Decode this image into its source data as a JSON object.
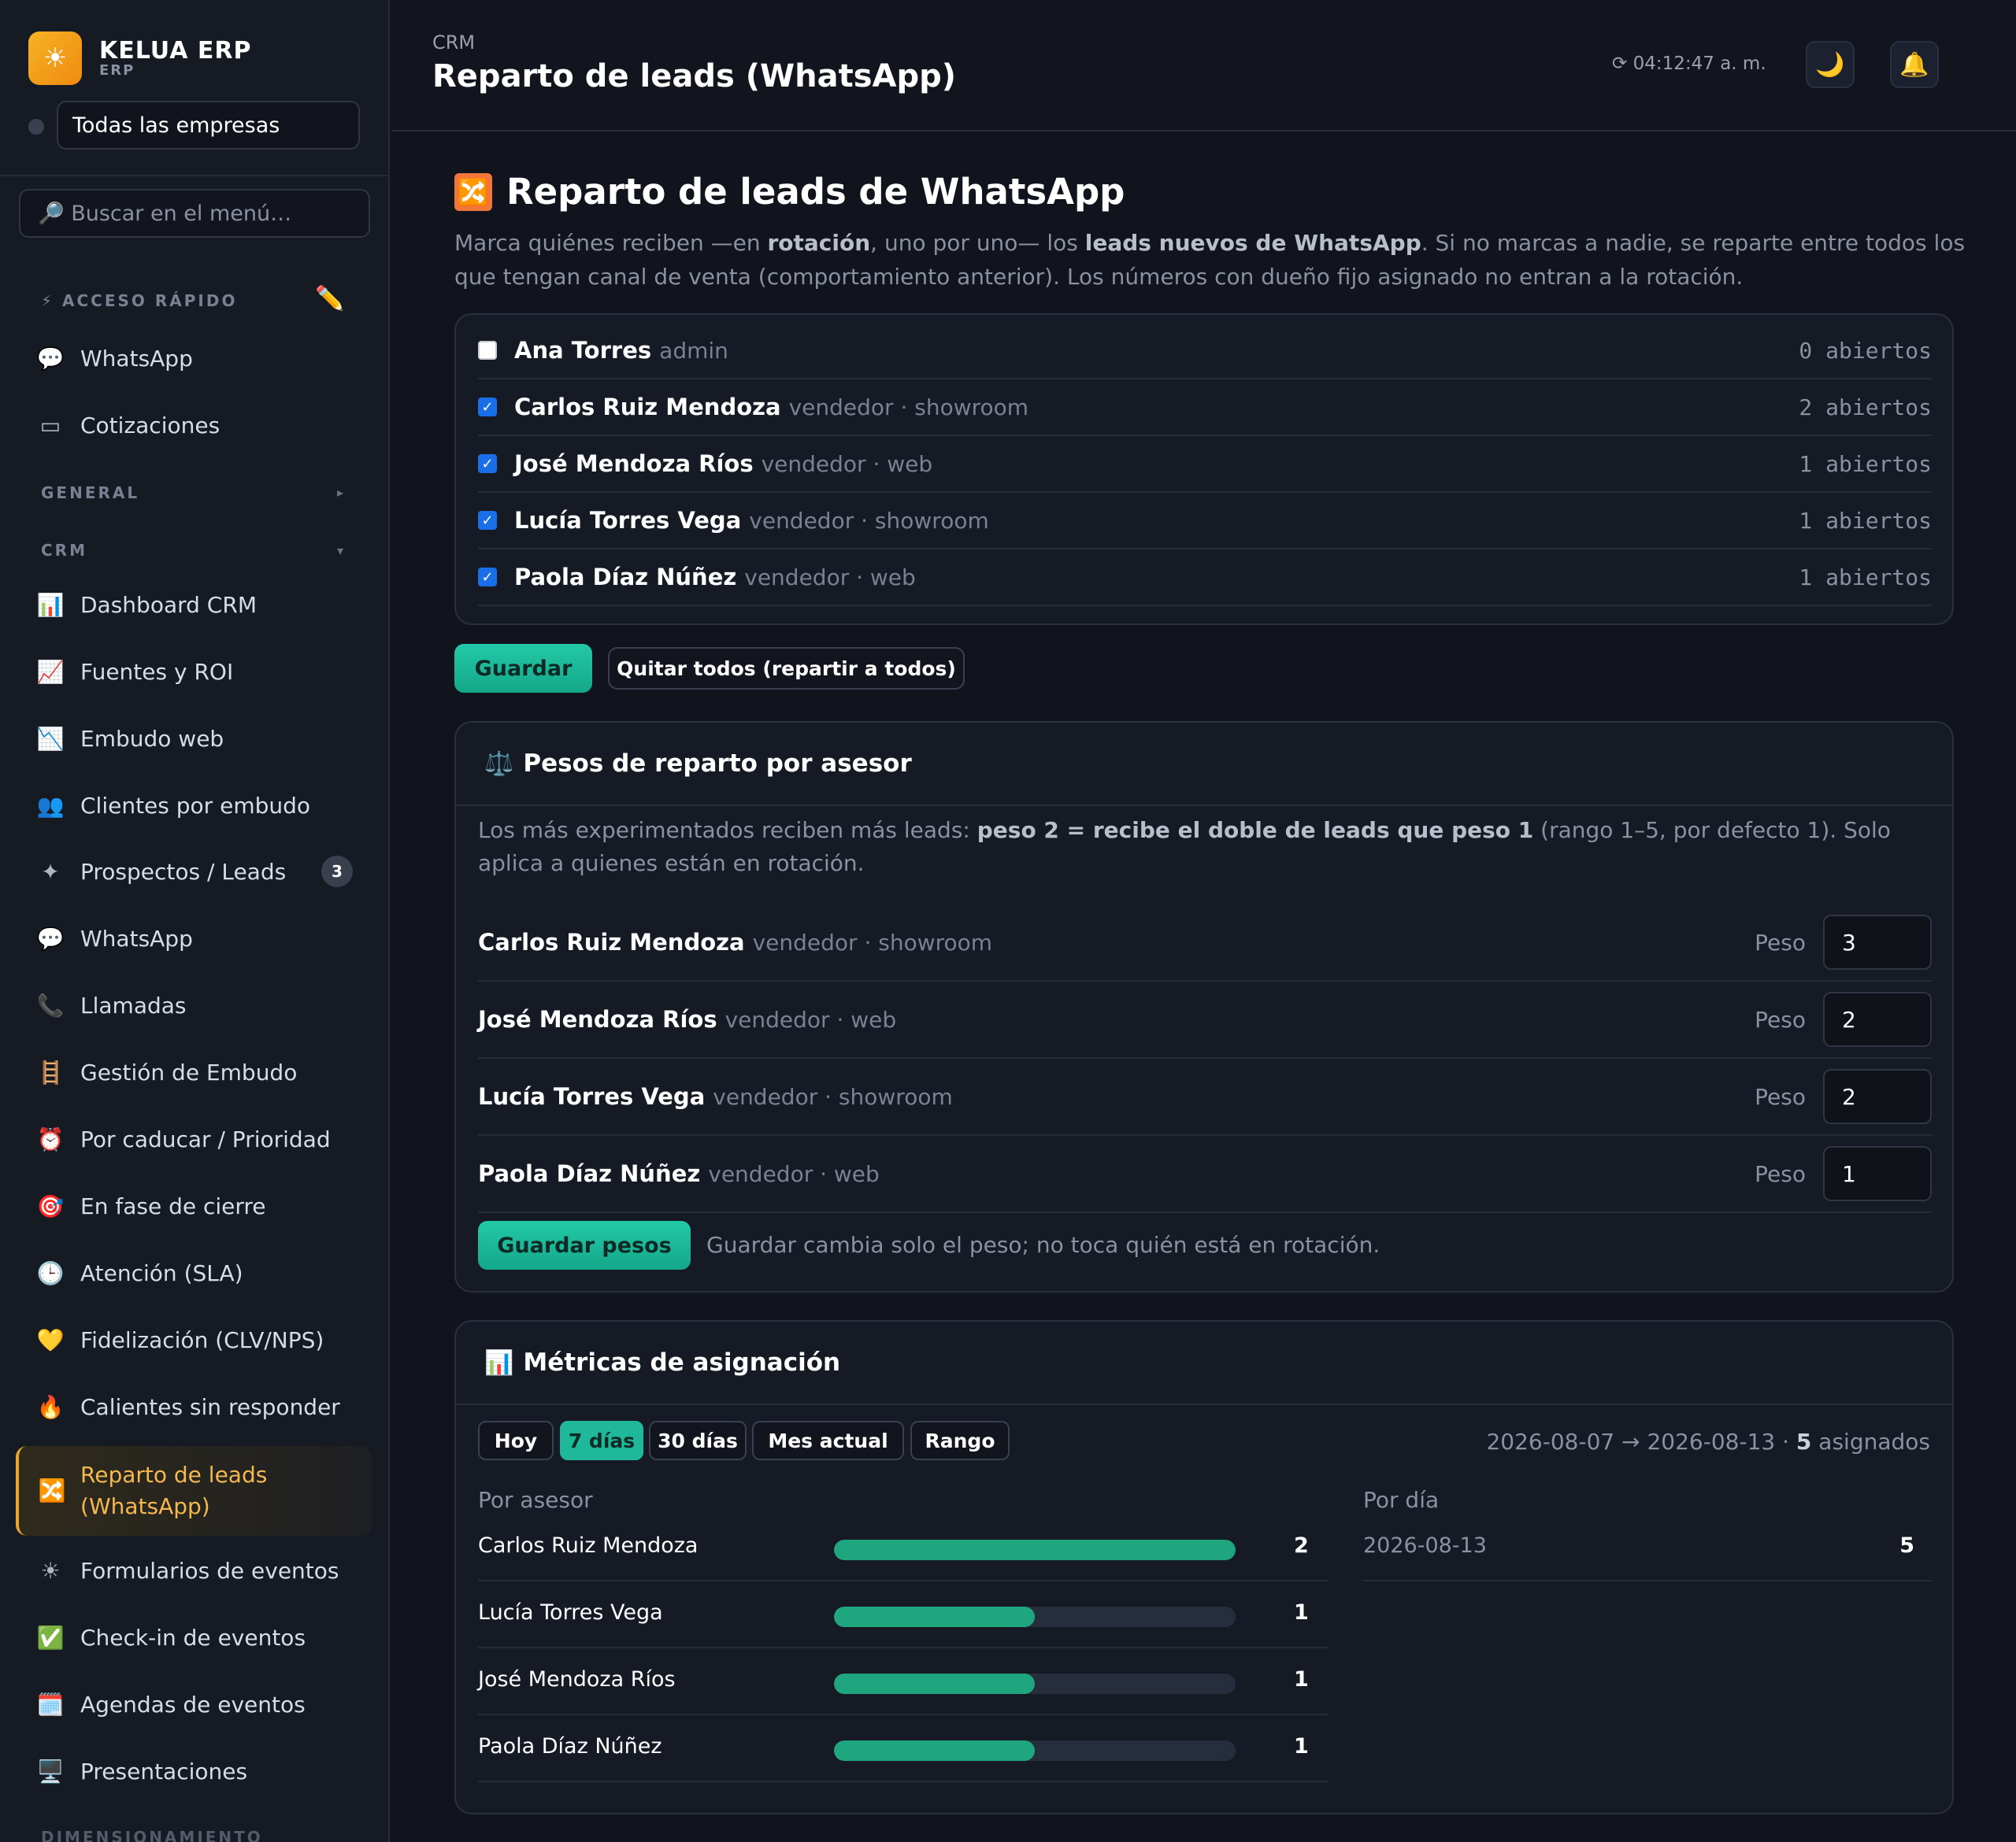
{
  "brand": {
    "logo_icon": "☀",
    "name": "KELUA ERP",
    "sub": "ERP"
  },
  "company_select": {
    "value": "Todas las empresas"
  },
  "menu_search": {
    "placeholder": "🔎 Buscar en el menú…"
  },
  "sidebar": {
    "sections": {
      "quick": "⚡ ACCESO RÁPIDO",
      "general": "GENERAL",
      "crm": "CRM",
      "sizing": "DIMENSIONAMIENTO"
    },
    "quick_items": [
      {
        "icon": "💬",
        "label": "WhatsApp"
      },
      {
        "icon": "▭",
        "label": "Cotizaciones"
      }
    ],
    "crm_items": [
      {
        "icon": "📊",
        "label": "Dashboard CRM"
      },
      {
        "icon": "📈",
        "label": "Fuentes y ROI"
      },
      {
        "icon": "📉",
        "label": "Embudo web"
      },
      {
        "icon": "👥",
        "label": "Clientes por embudo"
      },
      {
        "icon": "✦",
        "label": "Prospectos / Leads",
        "badge": "3"
      },
      {
        "icon": "💬",
        "label": "WhatsApp"
      },
      {
        "icon": "📞",
        "label": "Llamadas"
      },
      {
        "icon": "🪜",
        "label": "Gestión de Embudo"
      },
      {
        "icon": "⏰",
        "label": "Por caducar / Prioridad"
      },
      {
        "icon": "🎯",
        "label": "En fase de cierre"
      },
      {
        "icon": "🕒",
        "label": "Atención (SLA)"
      },
      {
        "icon": "💛",
        "label": "Fidelización (CLV/NPS)"
      },
      {
        "icon": "🔥",
        "label": "Calientes sin responder"
      },
      {
        "icon": "🔀",
        "label": "Reparto de leads (WhatsApp)",
        "active": true
      },
      {
        "icon": "☀",
        "label": "Formularios de eventos"
      },
      {
        "icon": "✅",
        "label": "Check-in de eventos"
      },
      {
        "icon": "🗓️",
        "label": "Agendas de eventos"
      },
      {
        "icon": "🖥️",
        "label": "Presentaciones"
      }
    ]
  },
  "header": {
    "breadcrumb": "CRM",
    "title": "Reparto de leads (WhatsApp)",
    "clock": "⟳ 04:12:47 a. m.",
    "theme_icon": "🌙",
    "bell_icon": "🔔"
  },
  "main": {
    "title_icon": "🔀",
    "title": "Reparto de leads de WhatsApp",
    "intro": {
      "p1": "Marca quiénes reciben —en ",
      "b1": "rotación",
      "p2": ", uno por uno— los ",
      "b2": "leads nuevos de WhatsApp",
      "p3": ". Si no marcas a nadie, se reparte entre todos los que tengan canal de venta (comportamiento anterior). Los números con dueño fijo asignado no entran a la rotación."
    },
    "rotation": [
      {
        "name": "Ana Torres",
        "role": "admin",
        "open": "0 abiertos",
        "checked": false
      },
      {
        "name": "Carlos Ruiz Mendoza",
        "role": "vendedor · showroom",
        "open": "2 abiertos",
        "checked": true
      },
      {
        "name": "José Mendoza Ríos",
        "role": "vendedor · web",
        "open": "1 abiertos",
        "checked": true
      },
      {
        "name": "Lucía Torres Vega",
        "role": "vendedor · showroom",
        "open": "1 abiertos",
        "checked": true
      },
      {
        "name": "Paola Díaz Núñez",
        "role": "vendedor · web",
        "open": "1 abiertos",
        "checked": true
      }
    ],
    "save_label": "Guardar",
    "clear_label": "Quitar todos (repartir a todos)"
  },
  "weights": {
    "icon": "⚖️",
    "title": "Pesos de reparto por asesor",
    "desc": {
      "p1": "Los más experimentados reciben más leads: ",
      "b1": "peso 2 = recibe el doble de leads que peso 1",
      "p2": " (rango 1–5, por defecto 1). Solo aplica a quienes están en rotación."
    },
    "weight_label": "Peso",
    "rows": [
      {
        "name": "Carlos Ruiz Mendoza",
        "role": "vendedor · showroom",
        "value": "3"
      },
      {
        "name": "José Mendoza Ríos",
        "role": "vendedor · web",
        "value": "2"
      },
      {
        "name": "Lucía Torres Vega",
        "role": "vendedor · showroom",
        "value": "2"
      },
      {
        "name": "Paola Díaz Núñez",
        "role": "vendedor · web",
        "value": "1"
      }
    ],
    "save_label": "Guardar pesos",
    "note": "Guardar cambia solo el peso; no toca quién está en rotación."
  },
  "metrics": {
    "icon": "📊",
    "title": "Métricas de asignación",
    "ranges": [
      {
        "label": "Hoy",
        "active": false
      },
      {
        "label": "7 días",
        "active": true
      },
      {
        "label": "30 días",
        "active": false
      },
      {
        "label": "Mes actual",
        "active": false
      },
      {
        "label": "Rango",
        "active": false
      }
    ],
    "range_text": "2026-08-07 → 2026-08-13 · ",
    "assigned_count": "5",
    "assigned_word": " asignados",
    "by_advisor_label": "Por asesor",
    "by_day_label": "Por día",
    "by_advisor": [
      {
        "name": "Carlos Ruiz Mendoza",
        "value": 2
      },
      {
        "name": "Lucía Torres Vega",
        "value": 1
      },
      {
        "name": "José Mendoza Ríos",
        "value": 1
      },
      {
        "name": "Paola Díaz Núñez",
        "value": 1
      }
    ],
    "by_advisor_max": 2,
    "by_day": [
      {
        "date": "2026-08-13",
        "value": "5"
      }
    ],
    "accent_color": "#1fa67e"
  },
  "colors": {
    "brand_orange": "#f29a16",
    "teal": "#1fb89b",
    "checkbox_blue": "#1a6ee8"
  }
}
